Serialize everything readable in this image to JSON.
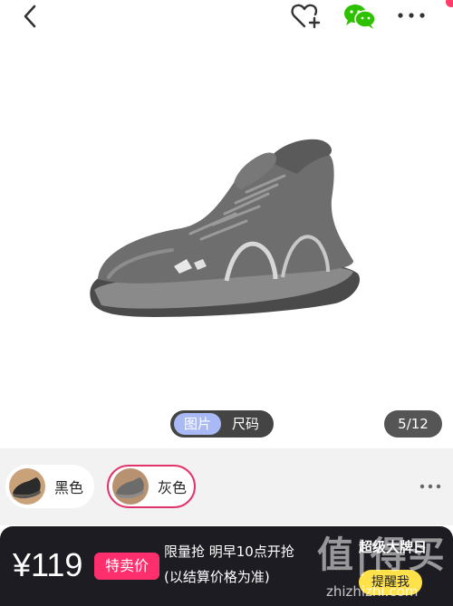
{
  "gallery": {
    "tabs": [
      {
        "label": "图片",
        "active": true
      },
      {
        "label": "尺码",
        "active": false
      }
    ],
    "counter": "5/12"
  },
  "variants": [
    {
      "label": "黑色",
      "selected": false
    },
    {
      "label": "灰色",
      "selected": true
    }
  ],
  "promo": {
    "price": "¥119",
    "badge": "特卖价",
    "line1": "限量抢 明早10点开抢",
    "line2": "(以结算价格为准)",
    "right_title": "超级大牌日",
    "remind_label": "提醒我"
  },
  "watermark": {
    "logo": "值|得买",
    "url": "zhizhizhi.com"
  },
  "colors": {
    "accent": "#e2336a",
    "badge": "#ff2f6d",
    "remind": "#ffe14a",
    "wechat": "#2dc100",
    "active_tab": "#a9b9f5"
  },
  "icons": [
    "back-icon",
    "favorite-add-icon",
    "wechat-icon",
    "more-icon"
  ]
}
